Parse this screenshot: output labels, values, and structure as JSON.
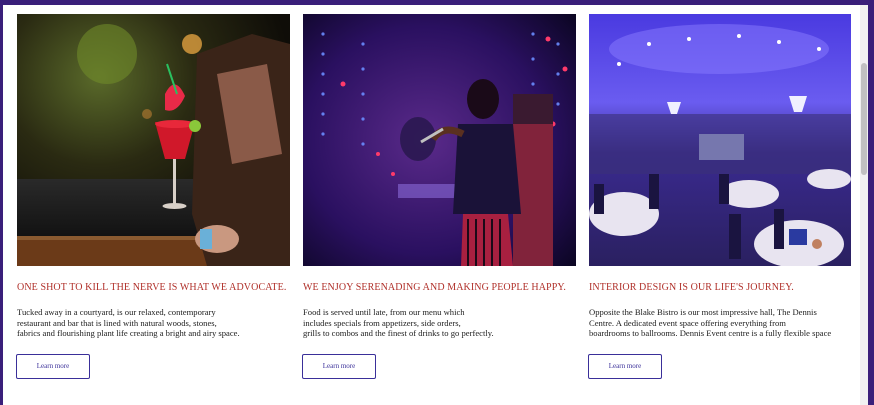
{
  "cards": [
    {
      "image": "cocktail-on-bar-photo",
      "heading": "ONE SHOT TO KILL THE NERVE IS WHAT WE ADVOCATE.",
      "lines": [
        "Tucked away in a courtyard, is our relaxed, contemporary",
        "restaurant and bar that is lined with natural woods, stones,",
        "fabrics and flourishing plant life creating a bright and airy space."
      ],
      "button": "Learn more"
    },
    {
      "image": "singer-on-stage-photo",
      "heading": "WE ENJOY SERENADING AND MAKING PEOPLE HAPPY.",
      "lines": [
        "Food is served until late, from our menu which",
        "includes specials from appetizers, side orders,",
        "grills to combos and the finest of drinks to go perfectly."
      ],
      "button": "Learn more"
    },
    {
      "image": "event-hall-photo",
      "heading": "INTERIOR DESIGN IS OUR LIFE'S JOURNEY.",
      "lines": [
        "Opposite the Blake Bistro is our most impressive hall, The Dennis",
        "Centre. A dedicated event space offering everything from",
        "boardrooms to ballrooms. Dennis Event centre is a fully flexible space"
      ],
      "button": "Learn more"
    }
  ],
  "colors": {
    "heading": "#b0302a",
    "button_border": "#3a2f99",
    "frame": "#3a1f7a"
  }
}
